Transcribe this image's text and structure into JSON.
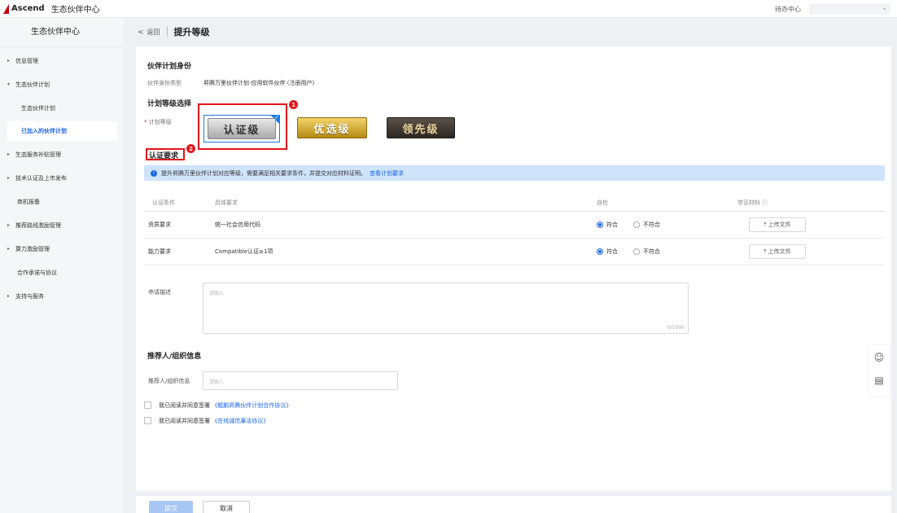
{
  "topbar": {
    "logo_text": "Ascend",
    "app_title": "生态伙伴中心",
    "todo": "待办中心",
    "user_chevron": "⌄"
  },
  "sidebar": {
    "title": "生态伙伴中心",
    "items": [
      {
        "label": "信息管理",
        "arrow": "▸"
      },
      {
        "label": "生态伙伴计划",
        "arrow": "▾"
      },
      {
        "label": "生态伙伴计划"
      },
      {
        "label": "已加入的伙伴计划"
      },
      {
        "label": "生态服务补贴管理",
        "arrow": "▸"
      },
      {
        "label": "技术认证及上市发布",
        "arrow": "▸"
      },
      {
        "label": "商机报备"
      },
      {
        "label": "推荐路线激励管理",
        "arrow": "▸"
      },
      {
        "label": "算力激励管理",
        "arrow": "▸"
      },
      {
        "label": "合作承诺与协议"
      },
      {
        "label": "支持与服务",
        "arrow": "▸"
      }
    ]
  },
  "header": {
    "back_arrow": "<",
    "back_label": "返回",
    "title": "提升等级"
  },
  "identity": {
    "section_title": "伙伴计划身份",
    "type_label": "伙伴身份类型",
    "type_value": "昇腾万里伙伴计划-应用软件伙伴 (注册用户)"
  },
  "level": {
    "section_title": "计划等级选择",
    "required_mark": "*",
    "field_label": "计划等级",
    "options": [
      "认证级",
      "优选级",
      "领先级"
    ],
    "selected": "认证级",
    "check": "✓"
  },
  "annotations": {
    "badge1": "1",
    "badge2": "2"
  },
  "requirements": {
    "section_title": "认证要求",
    "info_icon": "!",
    "info_text": "提升昇腾万里伙伴计划对应等级，需要满足相关要求条件，并提交对应材料证明。",
    "info_link": "查看计划要求",
    "columns": [
      "认证条件",
      "具体要求",
      "自检",
      "举证材料 ⓘ"
    ],
    "rows": [
      {
        "condition": "资质要求",
        "detail": "统一社会信用代码",
        "yes": "符合",
        "no": "不符合",
        "selected": "符合",
        "upload": "上传文件"
      },
      {
        "condition": "能力要求",
        "detail": "Compatible认证≥1项",
        "yes": "符合",
        "no": "不符合",
        "selected": "符合",
        "upload": "上传文件"
      }
    ],
    "upload_icon": "⤒"
  },
  "application": {
    "label": "申请描述",
    "placeholder": "请输入",
    "counter": "0/1000"
  },
  "referrer": {
    "section_title": "推荐人/组织信息",
    "label": "推荐人/组织信息",
    "placeholder": "请输入"
  },
  "agreements": [
    {
      "prefix": "我已阅读并同意签署",
      "link": "《鲲鹏昇腾伙伴计划合作协议》"
    },
    {
      "prefix": "我已阅读并同意签署",
      "link": "《在线诚信廉洁协议》"
    }
  ],
  "footer": {
    "submit": "提交",
    "cancel": "取消"
  },
  "float_tools": {
    "feedback_icon": "☺",
    "doc_icon": "▤"
  },
  "colors": {
    "accent": "#1a66e6",
    "highlight": "#e0151b",
    "info_bg": "#cfe3fb"
  }
}
